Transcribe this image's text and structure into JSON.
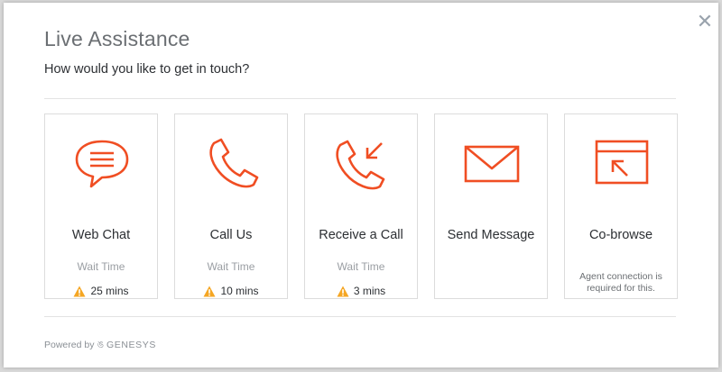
{
  "dialog": {
    "title": "Live Assistance",
    "subtitle": "How would you like to get in touch?",
    "close_icon": "close-icon"
  },
  "colors": {
    "accent": "#f04e23",
    "warning": "#f5a623"
  },
  "options": [
    {
      "label": "Web Chat",
      "icon": "chat-bubble-icon",
      "wait_label": "Wait Time",
      "wait_time": "25 mins"
    },
    {
      "label": "Call Us",
      "icon": "phone-icon",
      "wait_label": "Wait Time",
      "wait_time": "10 mins"
    },
    {
      "label": "Receive a Call",
      "icon": "incoming-call-icon",
      "wait_label": "Wait Time",
      "wait_time": "3 mins"
    },
    {
      "label": "Send Message",
      "icon": "envelope-icon"
    },
    {
      "label": "Co-browse",
      "icon": "cobrowse-icon",
      "note": "Agent connection is required for this."
    }
  ],
  "footer": {
    "powered_by": "Powered by",
    "brand": "GENESYS"
  }
}
